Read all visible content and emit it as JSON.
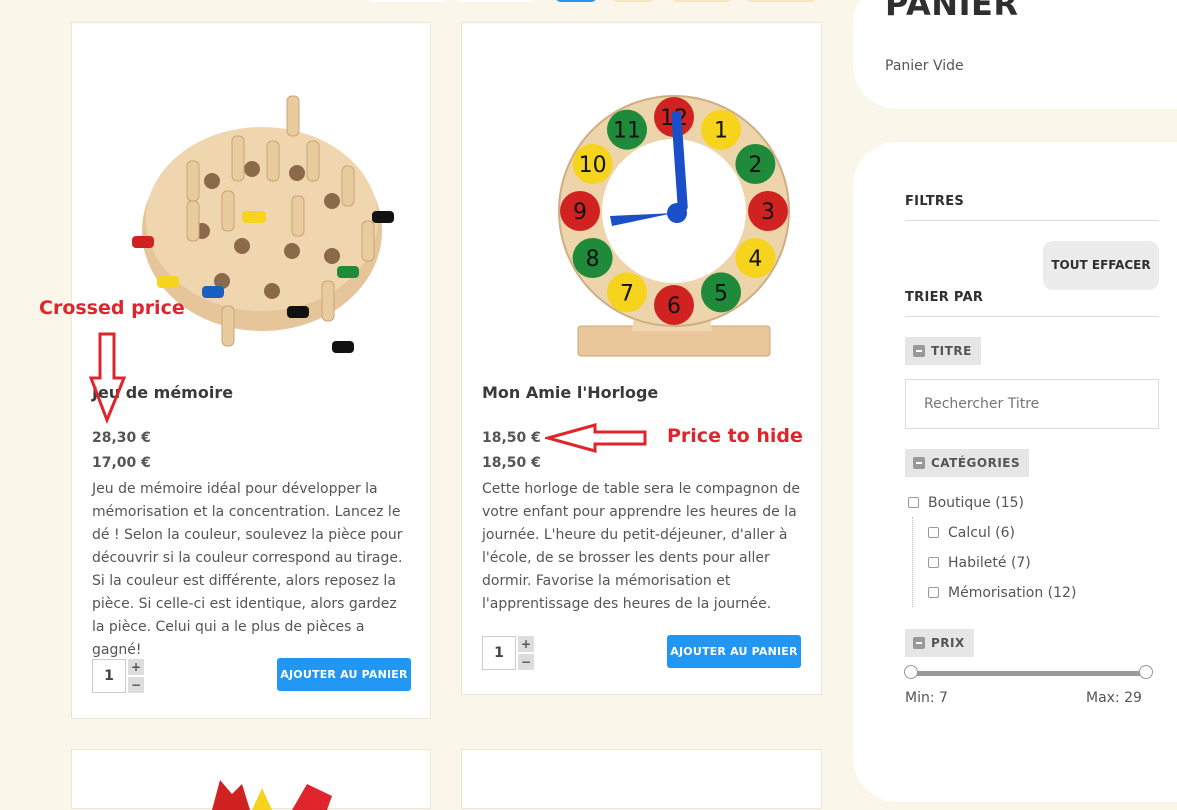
{
  "products": [
    {
      "title": "Jeu de mémoire",
      "price_crossed": "28,30 €",
      "price": "17,00 €",
      "description": "Jeu de mémoire idéal pour développer la mémorisation et la concentration. Lancez le dé ! Selon la couleur, soulevez la pièce pour découvrir si la couleur correspond au tirage. Si la couleur est différente, alors reposez la pièce. Si celle-ci est identique, alors gardez la pièce. Celui qui a le plus de pièces a gagné!",
      "quantity": "1",
      "add_label": "AJOUTER AU PANIER"
    },
    {
      "title": "Mon Amie l'Horloge",
      "price_crossed": "18,50 €",
      "price": "18,50 €",
      "description": "Cette horloge de table sera le compagnon de votre enfant pour apprendre les heures de la journée. L'heure du petit-déjeuner, d'aller à l'école, de se brosser les dents pour aller dormir. Favorise la mémorisation et l'apprentissage des heures de la journée.",
      "quantity": "1",
      "add_label": "AJOUTER AU PANIER"
    }
  ],
  "annotations": {
    "crossed": "Crossed price",
    "hide": "Price to hide"
  },
  "cart": {
    "title": "PANIER",
    "empty": "Panier Vide"
  },
  "filters": {
    "title": "FILTRES",
    "clear_all": "TOUT EFFACER",
    "sort_by": "TRIER PAR",
    "title_filter": {
      "label": "TITRE",
      "placeholder": "Rechercher Titre"
    },
    "categories": {
      "label": "CATÉGORIES",
      "items": [
        {
          "label": "Boutique (15)"
        },
        {
          "label": "Calcul (6)"
        },
        {
          "label": "Habileté (7)"
        },
        {
          "label": "Mémorisation (12)"
        }
      ]
    },
    "price": {
      "label": "PRIX",
      "min_text": "Min: 7",
      "max_text": "Max: 29",
      "min": 7,
      "max": 29
    }
  },
  "clock_numbers": [
    "12",
    "1",
    "2",
    "3",
    "4",
    "5",
    "6",
    "7",
    "8",
    "9",
    "10",
    "11"
  ],
  "colors": {
    "accent": "#2196f3",
    "annotation": "#e0242c",
    "background": "#fbf6ea"
  }
}
